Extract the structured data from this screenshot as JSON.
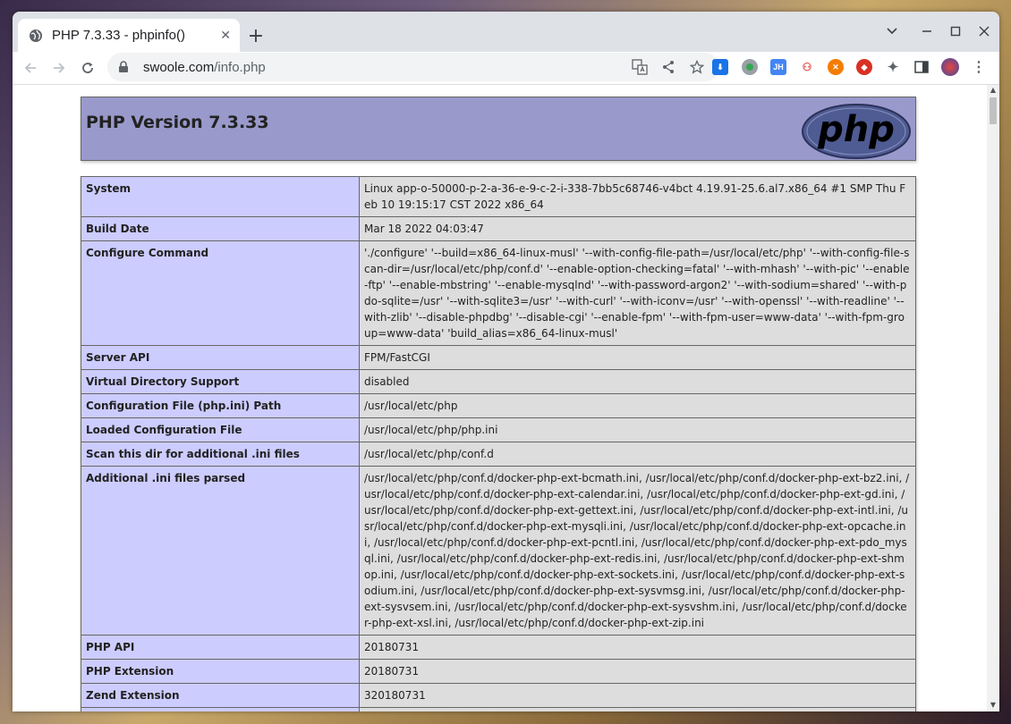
{
  "browser": {
    "tab_title": "PHP 7.3.33 - phpinfo()",
    "url_host": "swoole.com",
    "url_path": "/info.php"
  },
  "page": {
    "version_heading": "PHP Version 7.3.33",
    "logo_text": "php"
  },
  "rows": [
    {
      "key": "System",
      "value": "Linux app-o-50000-p-2-a-36-e-9-c-2-i-338-7bb5c68746-v4bct 4.19.91-25.6.al7.x86_64 #1 SMP Thu Feb 10 19:15:17 CST 2022 x86_64"
    },
    {
      "key": "Build Date",
      "value": "Mar 18 2022 04:03:47"
    },
    {
      "key": "Configure Command",
      "value": "'./configure' '--build=x86_64-linux-musl' '--with-config-file-path=/usr/local/etc/php' '--with-config-file-scan-dir=/usr/local/etc/php/conf.d' '--enable-option-checking=fatal' '--with-mhash' '--with-pic' '--enable-ftp' '--enable-mbstring' '--enable-mysqlnd' '--with-password-argon2' '--with-sodium=shared' '--with-pdo-sqlite=/usr' '--with-sqlite3=/usr' '--with-curl' '--with-iconv=/usr' '--with-openssl' '--with-readline' '--with-zlib' '--disable-phpdbg' '--disable-cgi' '--enable-fpm' '--with-fpm-user=www-data' '--with-fpm-group=www-data' 'build_alias=x86_64-linux-musl'"
    },
    {
      "key": "Server API",
      "value": "FPM/FastCGI"
    },
    {
      "key": "Virtual Directory Support",
      "value": "disabled"
    },
    {
      "key": "Configuration File (php.ini) Path",
      "value": "/usr/local/etc/php"
    },
    {
      "key": "Loaded Configuration File",
      "value": "/usr/local/etc/php/php.ini"
    },
    {
      "key": "Scan this dir for additional .ini files",
      "value": "/usr/local/etc/php/conf.d"
    },
    {
      "key": "Additional .ini files parsed",
      "value": "/usr/local/etc/php/conf.d/docker-php-ext-bcmath.ini, /usr/local/etc/php/conf.d/docker-php-ext-bz2.ini, /usr/local/etc/php/conf.d/docker-php-ext-calendar.ini, /usr/local/etc/php/conf.d/docker-php-ext-gd.ini, /usr/local/etc/php/conf.d/docker-php-ext-gettext.ini, /usr/local/etc/php/conf.d/docker-php-ext-intl.ini, /usr/local/etc/php/conf.d/docker-php-ext-mysqli.ini, /usr/local/etc/php/conf.d/docker-php-ext-opcache.ini, /usr/local/etc/php/conf.d/docker-php-ext-pcntl.ini, /usr/local/etc/php/conf.d/docker-php-ext-pdo_mysql.ini, /usr/local/etc/php/conf.d/docker-php-ext-redis.ini, /usr/local/etc/php/conf.d/docker-php-ext-shmop.ini, /usr/local/etc/php/conf.d/docker-php-ext-sockets.ini, /usr/local/etc/php/conf.d/docker-php-ext-sodium.ini, /usr/local/etc/php/conf.d/docker-php-ext-sysvmsg.ini, /usr/local/etc/php/conf.d/docker-php-ext-sysvsem.ini, /usr/local/etc/php/conf.d/docker-php-ext-sysvshm.ini, /usr/local/etc/php/conf.d/docker-php-ext-xsl.ini, /usr/local/etc/php/conf.d/docker-php-ext-zip.ini"
    },
    {
      "key": "PHP API",
      "value": "20180731"
    },
    {
      "key": "PHP Extension",
      "value": "20180731"
    },
    {
      "key": "Zend Extension",
      "value": "320180731"
    },
    {
      "key": "",
      "value": ""
    }
  ],
  "colors": {
    "header_bg": "#9999cc",
    "key_bg": "#ccccff",
    "value_bg": "#dddddd"
  }
}
